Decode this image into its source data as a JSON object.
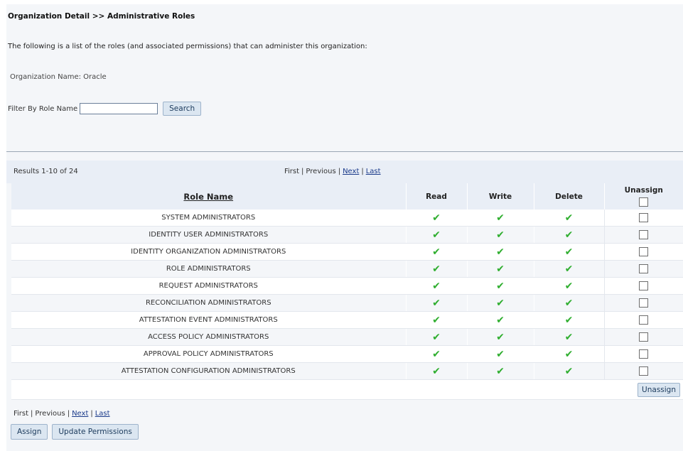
{
  "breadcrumb": "Organization Detail >> Administrative Roles",
  "description": "The following is a list of the roles (and associated permissions) that can administer this organization:",
  "organization_name": "Organization Name: Oracle",
  "filter": {
    "label": "Filter By Role Name",
    "value": "",
    "search_label": "Search"
  },
  "results": {
    "count_text": "Results 1-10 of 24",
    "pager": {
      "first": "First",
      "previous": "Previous",
      "next": "Next",
      "last": "Last",
      "separator": "|"
    }
  },
  "table": {
    "columns": {
      "role_name": "Role Name",
      "read": "Read",
      "write": "Write",
      "delete": "Delete",
      "unassign": "Unassign"
    },
    "rows": [
      {
        "name": "SYSTEM ADMINISTRATORS",
        "read": true,
        "write": true,
        "delete": true,
        "unassign": false
      },
      {
        "name": "IDENTITY USER ADMINISTRATORS",
        "read": true,
        "write": true,
        "delete": true,
        "unassign": false
      },
      {
        "name": "IDENTITY ORGANIZATION ADMINISTRATORS",
        "read": true,
        "write": true,
        "delete": true,
        "unassign": false
      },
      {
        "name": "ROLE ADMINISTRATORS",
        "read": true,
        "write": true,
        "delete": true,
        "unassign": false
      },
      {
        "name": "REQUEST ADMINISTRATORS",
        "read": true,
        "write": true,
        "delete": true,
        "unassign": false
      },
      {
        "name": "RECONCILIATION ADMINISTRATORS",
        "read": true,
        "write": true,
        "delete": true,
        "unassign": false
      },
      {
        "name": "ATTESTATION EVENT ADMINISTRATORS",
        "read": true,
        "write": true,
        "delete": true,
        "unassign": false
      },
      {
        "name": "ACCESS POLICY ADMINISTRATORS",
        "read": true,
        "write": true,
        "delete": true,
        "unassign": false
      },
      {
        "name": "APPROVAL POLICY ADMINISTRATORS",
        "read": true,
        "write": true,
        "delete": true,
        "unassign": false
      },
      {
        "name": "ATTESTATION CONFIGURATION ADMINISTRATORS",
        "read": true,
        "write": true,
        "delete": true,
        "unassign": false
      }
    ],
    "unassign_button": "Unassign",
    "check_glyph": "✔",
    "check_color": "#2fae2f"
  },
  "actions": {
    "assign": "Assign",
    "update_permissions": "Update Permissions"
  }
}
